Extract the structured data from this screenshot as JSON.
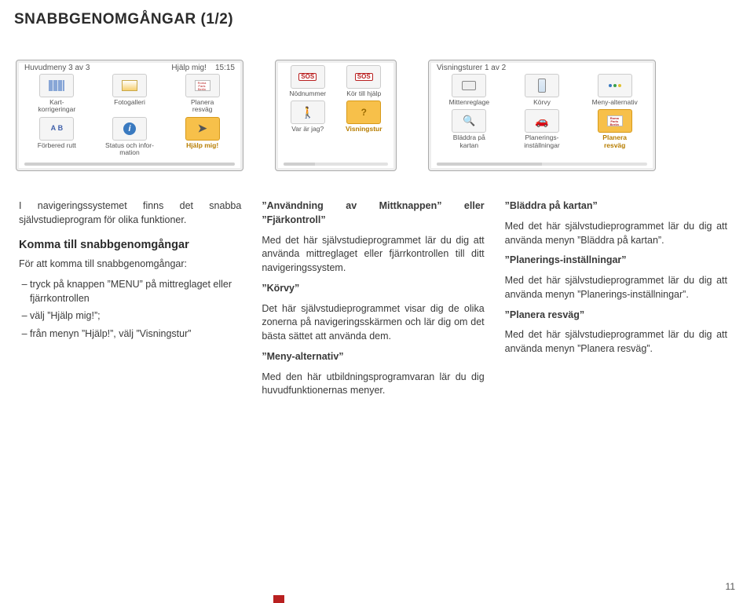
{
  "page_title": "SNABBGENOMGÅNGAR (1/2)",
  "page_number": "11",
  "device_a": {
    "header_left": "Huvudmeny 3 av 3",
    "header_right_a": "Hjälp mig!",
    "header_right_b": "15:15",
    "tiles": [
      {
        "label": "Kart-\nkorrigeringar",
        "icon": "grid"
      },
      {
        "label": "Fotogalleri",
        "icon": "gallery"
      },
      {
        "label": "Planera\nresväg",
        "icon": "route"
      },
      {
        "label": "Förbered rutt",
        "icon": "ab"
      },
      {
        "label": "Status och infor-\nmation",
        "icon": "i"
      },
      {
        "label": "Hjälp mig!",
        "icon": "help",
        "highlight": true
      }
    ]
  },
  "device_b": {
    "tiles": [
      {
        "label": "Nödnummer",
        "icon": "sos"
      },
      {
        "label": "Kör till hjälp",
        "icon": "sos"
      },
      {
        "label": "Var är jag?",
        "icon": "person"
      },
      {
        "label": "Visningstur",
        "icon": "qmark",
        "highlight": true
      }
    ]
  },
  "device_c": {
    "header_left": "Visningsturer 1 av 2",
    "tiles": [
      {
        "label": "Mittenreglage",
        "icon": "ctrl"
      },
      {
        "label": "Körvy",
        "icon": "remote"
      },
      {
        "label": "Meny-alternativ",
        "icon": "dots"
      },
      {
        "label": "Bläddra på\nkartan",
        "icon": "map"
      },
      {
        "label": "Planerings-\ninställningar",
        "icon": "car"
      },
      {
        "label": "Planera\nresväg",
        "icon": "route",
        "highlight": true
      }
    ]
  },
  "col1": {
    "intro": "I navigeringssystemet finns det snabba självstudieprogram för olika funktioner.",
    "heading": "Komma till snabbgenomgångar",
    "sub": "För att komma till snabbgenomgångar:",
    "items": [
      "tryck på knappen ”MENU” på mittreglaget eller fjärrkontrollen",
      "välj ”Hjälp mig!”;",
      "från menyn ”Hjälp!”, välj ”Visningstur”"
    ]
  },
  "col2": {
    "h1": "”Användning av Mittknappen” eller ”Fjärkontroll”",
    "p1": "Med det här självstudieprogrammet lär du dig att använda mittreglaget eller fjärrkontrollen till ditt navigeringssystem.",
    "h2": "”Körvy”",
    "p2": "Det här självstudieprogrammet visar dig de olika zonerna på navigeringsskärmen och lär dig om det bästa sättet att använda dem.",
    "h3": "”Meny-alternativ”",
    "p3": "Med den här utbildningsprogramvaran lär du dig huvudfunktionernas menyer."
  },
  "col3": {
    "h1": "”Bläddra på kartan”",
    "p1": "Med det här självstudieprogrammet lär du dig att använda menyn ”Bläddra på kartan”.",
    "h2": "”Planerings-inställningar”",
    "p2": "Med det här självstudieprogrammet lär du dig att använda menyn ”Planerings-inställningar”.",
    "h3": "”Planera resväg”",
    "p3": "Med det här självstudieprogrammet lär du dig att använda menyn ”Planera resväg”."
  }
}
